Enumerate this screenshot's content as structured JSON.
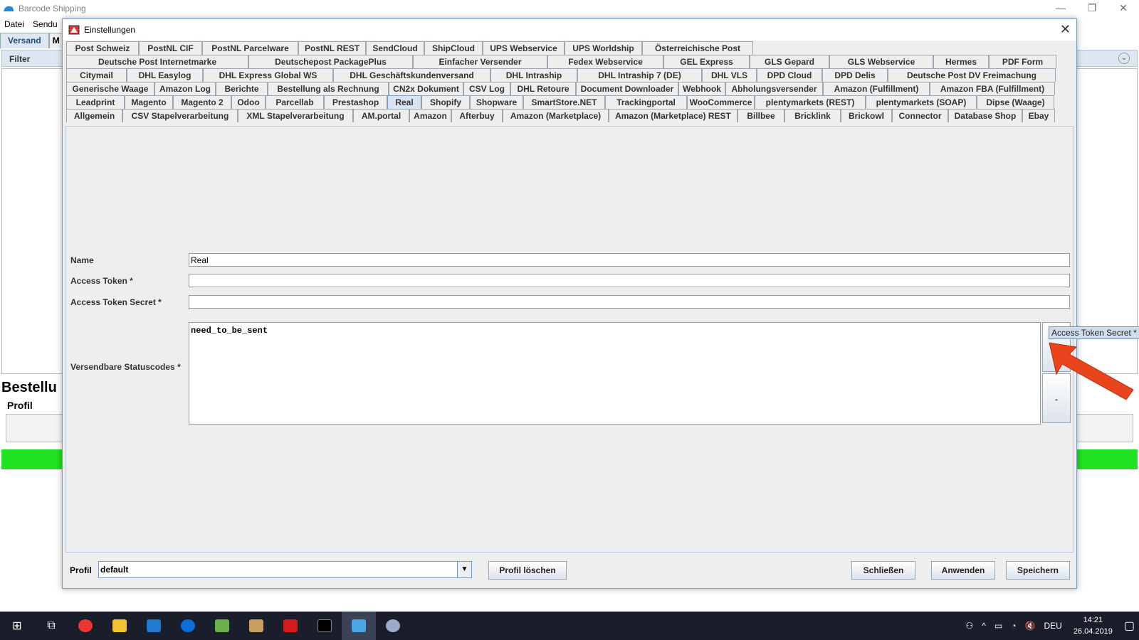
{
  "app": {
    "title": "Barcode Shipping",
    "menu": [
      "Datei",
      "Sendu"
    ],
    "tabs": [
      "Versand",
      "M"
    ],
    "filter_label": "Filter",
    "partial_label": "Bestellu",
    "profil_label": "Profil"
  },
  "dialog": {
    "title": "Einstellungen",
    "tab_rows": [
      [
        "Post Schweiz",
        "PostNL CIF",
        "PostNL Parcelware",
        "PostNL REST",
        "SendCloud",
        "ShipCloud",
        "UPS Webservice",
        "UPS Worldship",
        "Österreichische Post"
      ],
      [
        "Deutsche Post Internetmarke",
        "Deutschepost PackagePlus",
        "Einfacher Versender",
        "Fedex Webservice",
        "GEL Express",
        "GLS Gepard",
        "GLS Webservice",
        "Hermes",
        "PDF Form"
      ],
      [
        "Citymail",
        "DHL Easylog",
        "DHL Express Global WS",
        "DHL Geschäftskundenversand",
        "DHL Intraship",
        "DHL Intraship 7 (DE)",
        "DHL VLS",
        "DPD Cloud",
        "DPD Delis",
        "Deutsche Post DV Freimachung"
      ],
      [
        "Generische Waage",
        "Amazon Log",
        "Berichte",
        "Bestellung als Rechnung",
        "CN2x Dokument",
        "CSV Log",
        "DHL Retoure",
        "Document Downloader",
        "Webhook",
        "Abholungsversender",
        "Amazon (Fulfillment)",
        "Amazon FBA (Fulfillment)"
      ],
      [
        "Leadprint",
        "Magento",
        "Magento 2",
        "Odoo",
        "Parcellab",
        "Prestashop",
        "Real",
        "Shopify",
        "Shopware",
        "SmartStore.NET",
        "Trackingportal",
        "WooCommerce",
        "plentymarkets (REST)",
        "plentymarkets (SOAP)",
        "Dipse (Waage)"
      ],
      [
        "Allgemein",
        "CSV Stapelverarbeitung",
        "XML Stapelverarbeitung",
        "AM.portal",
        "Amazon",
        "Afterbuy",
        "Amazon (Marketplace)",
        "Amazon (Marketplace) REST",
        "Billbee",
        "Bricklink",
        "Brickowl",
        "Connector",
        "Database Shop",
        "Ebay"
      ]
    ],
    "active_tab": "Real",
    "form": {
      "name_label": "Name",
      "name_value": "Real",
      "access_token_label": "Access Token *",
      "access_token_value": "",
      "access_token_secret_label": "Access Token Secret *",
      "access_token_secret_value": "",
      "status_label": "Versendbare Statuscodes *",
      "status_value": "need_to_be_sent",
      "add_button": "+",
      "remove_button": "-"
    },
    "tooltip": "Access Token Secret *",
    "bottom": {
      "profil_label": "Profil",
      "profil_value": "default",
      "delete_profile": "Profil löschen",
      "close": "Schließen",
      "apply": "Anwenden",
      "save": "Speichern"
    }
  },
  "taskbar": {
    "language": "DEU",
    "time": "14:21",
    "date": "26.04.2019"
  }
}
